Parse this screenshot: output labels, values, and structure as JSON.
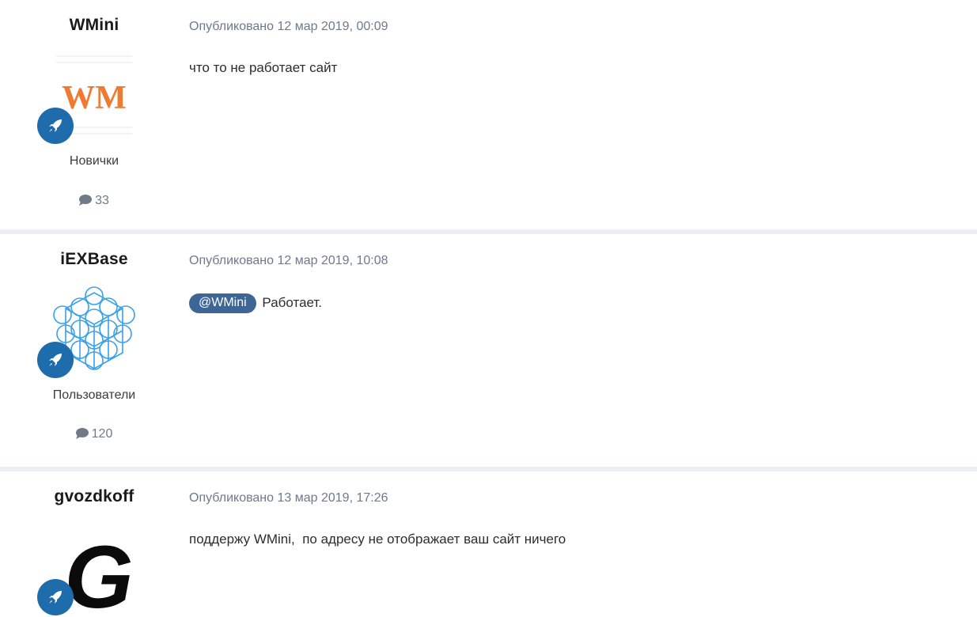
{
  "colors": {
    "page_background": "#ebeef2",
    "post_background": "#ffffff",
    "rank_badge": "#1f6cac",
    "mention_background": "#3d6595",
    "meta_text": "#6d7a8c"
  },
  "posts": [
    {
      "author": "WMini",
      "avatar_icon": "wm-logo-avatar",
      "avatar_text": "WM",
      "rank_icon": "rocket-icon",
      "group": "Новички",
      "post_count_icon": "comment-icon",
      "post_count": "33",
      "published": "Опубликовано 12 мар 2019, 00:09",
      "body": "что то не работает сайт"
    },
    {
      "author": "iEXBase",
      "avatar_icon": "cube-grid-avatar",
      "rank_icon": "rocket-icon",
      "group": "Пользователи",
      "post_count_icon": "comment-icon",
      "post_count": "120",
      "published": "Опубликовано 12 мар 2019, 10:08",
      "mention": "@WMini",
      "body": "Работает."
    },
    {
      "author": "gvozdkoff",
      "avatar_icon": "letter-g-avatar",
      "avatar_text": "G",
      "rank_icon": "rocket-icon",
      "published": "Опубликовано 13 мар 2019, 17:26",
      "body": "поддержу WMini,  по адресу не отображает ваш сайт ничего"
    }
  ]
}
